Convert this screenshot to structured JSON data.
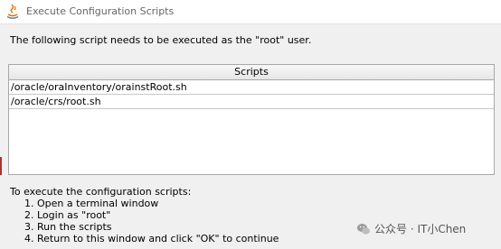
{
  "window": {
    "title": "Execute Configuration Scripts",
    "icon": "java-icon"
  },
  "instruction": "The following script needs to be executed as the \"root\" user.",
  "scripts_table": {
    "header": "Scripts",
    "rows": [
      "/oracle/oraInventory/orainstRoot.sh",
      "/oracle/crs/root.sh"
    ]
  },
  "footer": {
    "heading": "To execute the configuration scripts:",
    "steps": [
      "1. Open a terminal window",
      "2. Login as \"root\"",
      "3. Run the scripts",
      "4. Return to this window and click \"OK\" to continue"
    ]
  },
  "watermark": {
    "icon": "wechat-icon",
    "text": "公众号 · IT小Chen"
  }
}
